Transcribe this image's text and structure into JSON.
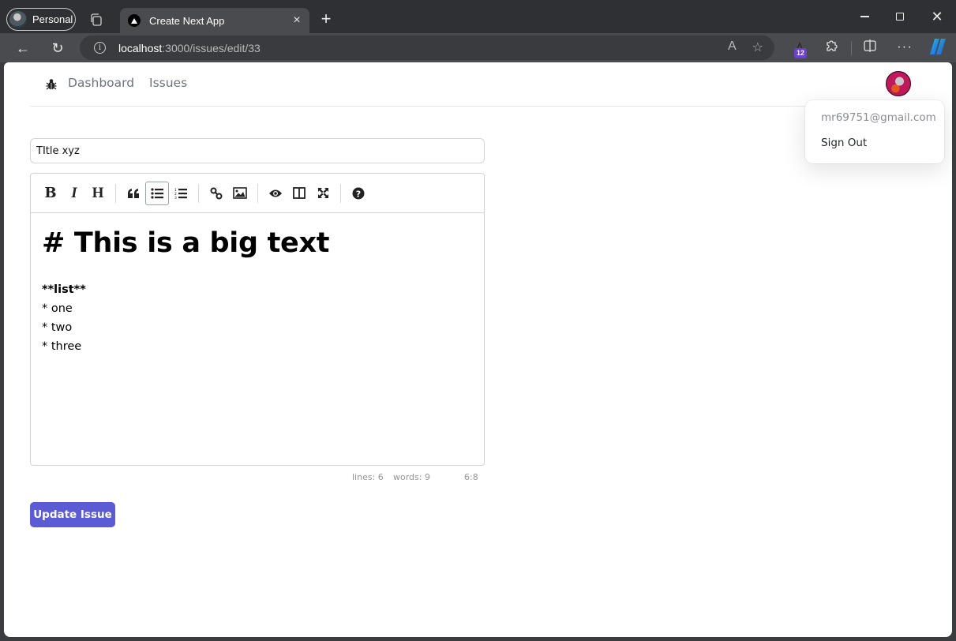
{
  "browser": {
    "profile_label": "Personal",
    "tab_title": "Create Next App",
    "url_host": "localhost",
    "url_rest": ":3000/issues/edit/33",
    "extension_badge": "12",
    "icons": {
      "collections": "collections-icon",
      "close_tab": "×",
      "new_tab": "+",
      "back": "←",
      "reload": "↻",
      "info": "i",
      "read_aloud": "A",
      "favorite": "☆",
      "extensions": "puzzle-icon",
      "split_screen": "split-icon",
      "more": "···",
      "close_window": "✕"
    }
  },
  "navbar": {
    "links": [
      {
        "label": "Dashboard"
      },
      {
        "label": "Issues"
      }
    ]
  },
  "user_menu": {
    "email": "mr69751@gmail.com",
    "sign_out_label": "Sign Out"
  },
  "form": {
    "title_value": "TItle xyz",
    "editor": {
      "toolbar": [
        {
          "name": "bold",
          "glyph": "B"
        },
        {
          "name": "italic",
          "glyph": "I"
        },
        {
          "name": "heading",
          "glyph": "H"
        },
        {
          "name": "quote",
          "glyph": "❝"
        },
        {
          "name": "unordered-list",
          "active": true
        },
        {
          "name": "ordered-list"
        },
        {
          "name": "link"
        },
        {
          "name": "image"
        },
        {
          "name": "preview"
        },
        {
          "name": "side-by-side"
        },
        {
          "name": "fullscreen"
        },
        {
          "name": "guide"
        }
      ],
      "content": {
        "heading": "# This is a big text",
        "bold_line": "**list**",
        "items": [
          "* one",
          "* two",
          "* three"
        ]
      },
      "status": {
        "lines": "lines: 6",
        "words": "words: 9",
        "cursor": "6:8"
      }
    },
    "submit_label": "Update Issue",
    "colors": {
      "primary": "#5b5bd6"
    }
  }
}
